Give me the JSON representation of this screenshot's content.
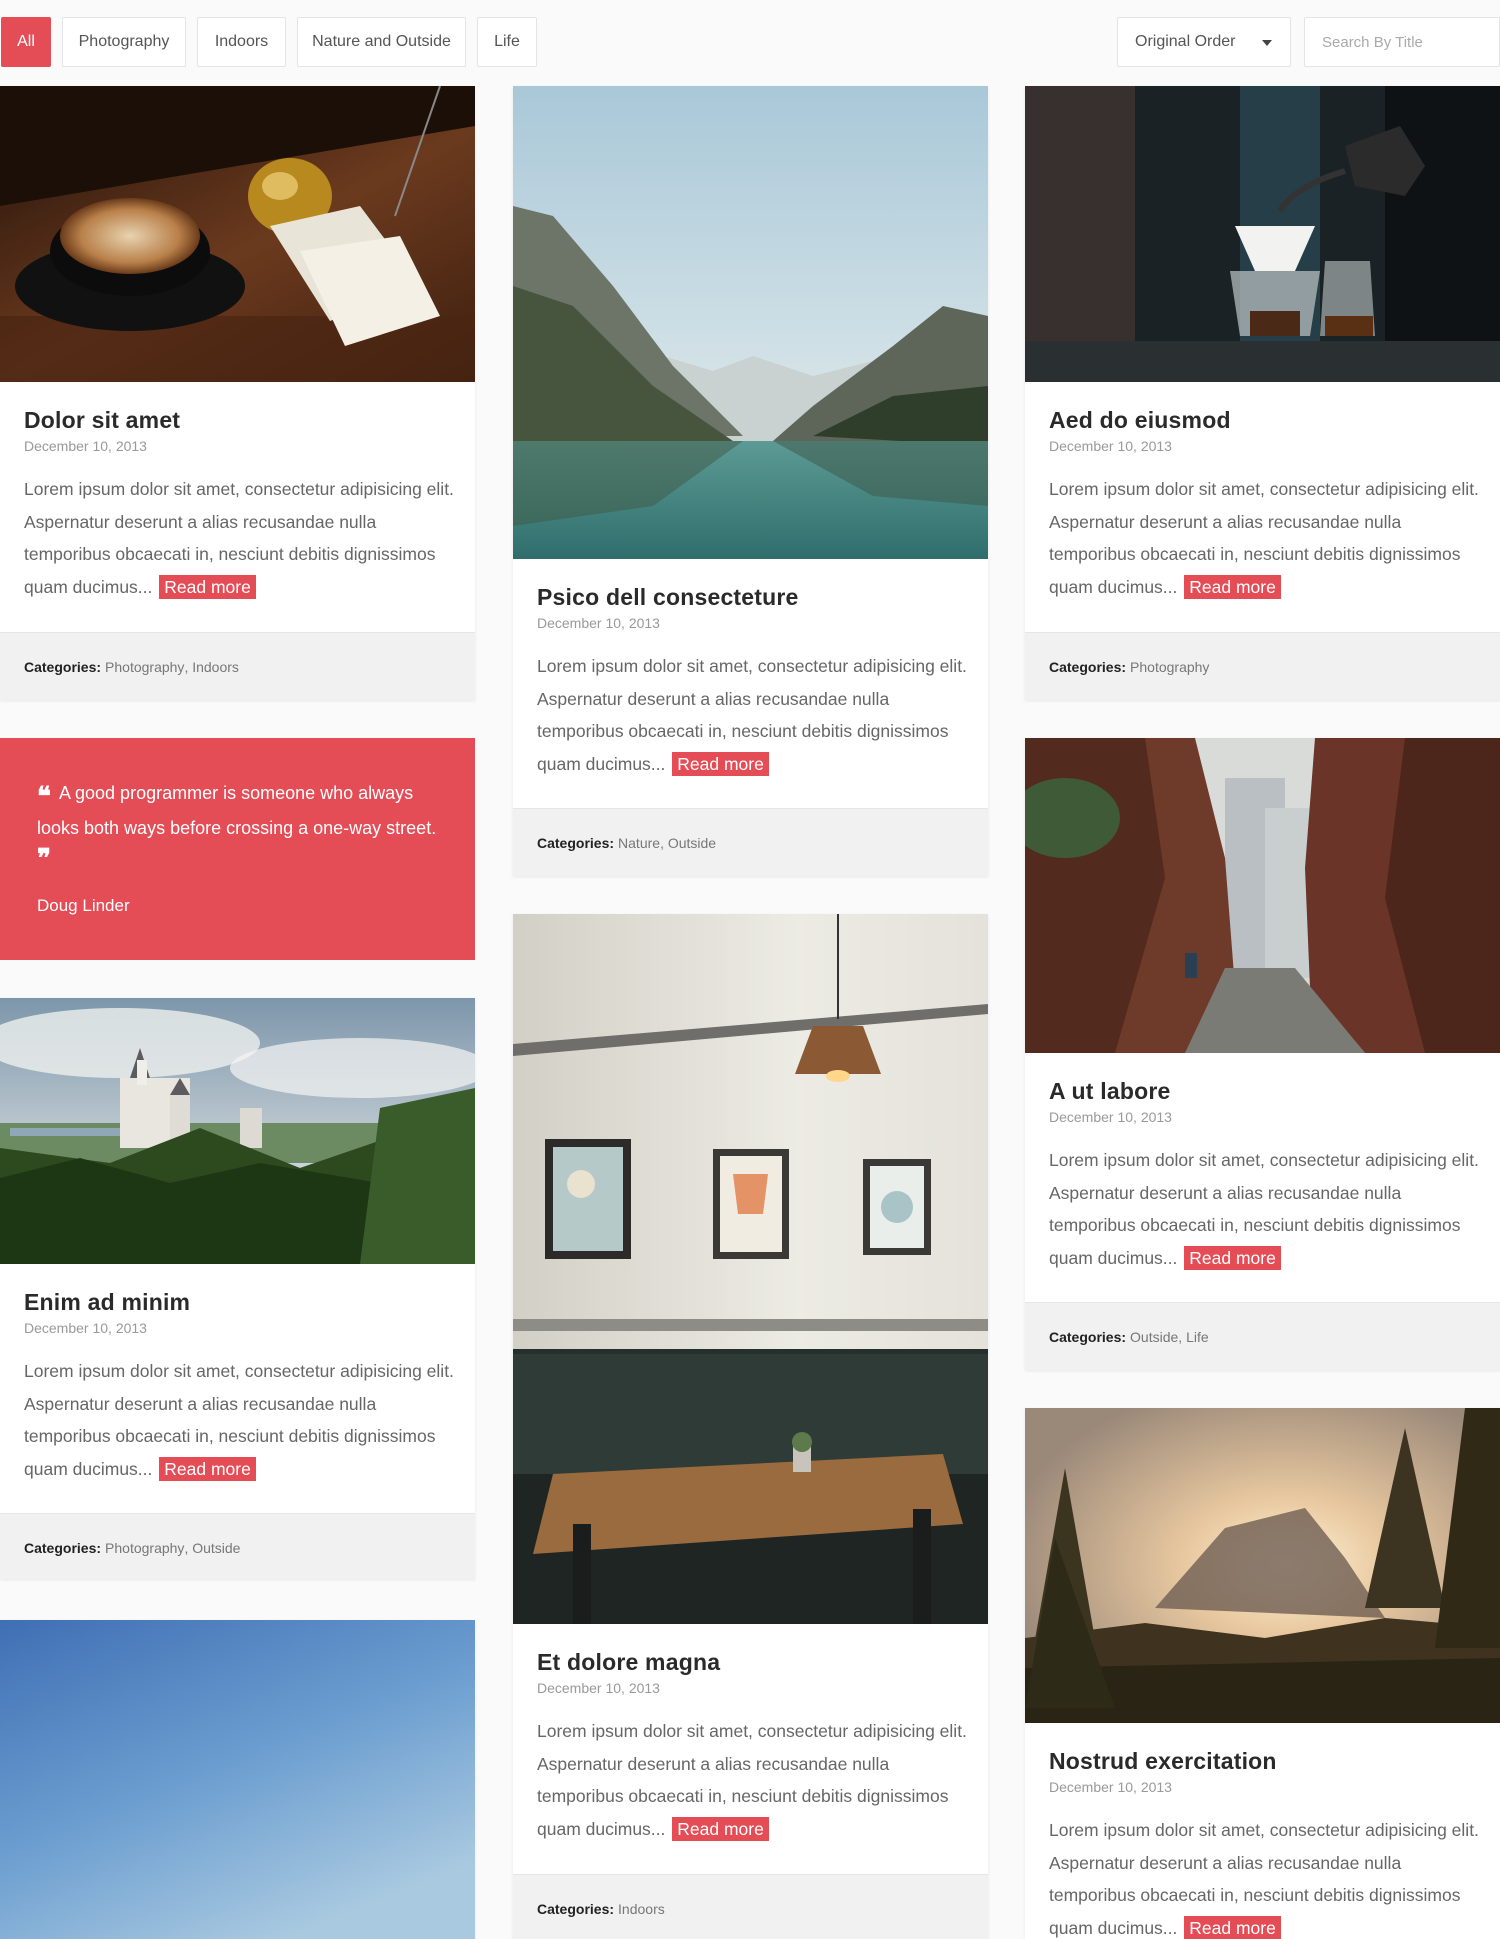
{
  "filters": [
    {
      "label": "All",
      "active": true
    },
    {
      "label": "Photography",
      "active": false
    },
    {
      "label": "Indoors",
      "active": false
    },
    {
      "label": "Nature and Outside",
      "active": false
    },
    {
      "label": "Life",
      "active": false
    }
  ],
  "sort": {
    "selected": "Original Order"
  },
  "search": {
    "placeholder": "Search By Title"
  },
  "colors": {
    "accent": "#e44c56",
    "footer_bg": "#f1f1f1",
    "page_bg": "#fafafa"
  },
  "read_more_label": "Read more",
  "categories_label": "Categories:",
  "posts": [
    {
      "title": "Dolor sit amet",
      "date": "December 10, 2013",
      "excerpt": "Lorem ipsum dolor sit amet, consectetur adipisicing elit. Aspernatur deserunt a alias recusandae nulla temporibus obcaecati in, nesciunt debitis dignissimos quam ducimus...",
      "categories": [
        "Photography",
        "Indoors"
      ],
      "image": "coffee-cup-photo"
    },
    {
      "title": "Psico dell consecteture",
      "date": "December 10, 2013",
      "excerpt": "Lorem ipsum dolor sit amet, consectetur adipisicing elit. Aspernatur deserunt a alias recusandae nulla temporibus obcaecati in, nesciunt debitis dignissimos quam ducimus...",
      "categories": [
        "Nature",
        "Outside"
      ],
      "image": "mountain-lake-photo"
    },
    {
      "title": "Aed do eiusmod",
      "date": "December 10, 2013",
      "excerpt": "Lorem ipsum dolor sit amet, consectetur adipisicing elit. Aspernatur deserunt a alias recusandae nulla temporibus obcaecati in, nesciunt debitis dignissimos quam ducimus...",
      "categories": [
        "Photography"
      ],
      "image": "coffee-brewing-photo"
    },
    {
      "title": "A ut labore",
      "date": "December 10, 2013",
      "excerpt": "Lorem ipsum dolor sit amet, consectetur adipisicing elit. Aspernatur deserunt a alias recusandae nulla temporibus obcaecati in, nesciunt debitis dignissimos quam ducimus...",
      "categories": [
        "Outside",
        "Life"
      ],
      "image": "brick-alley-photo"
    },
    {
      "title": "Enim ad minim",
      "date": "December 10, 2013",
      "excerpt": "Lorem ipsum dolor sit amet, consectetur adipisicing elit. Aspernatur deserunt a alias recusandae nulla temporibus obcaecati in, nesciunt debitis dignissimos quam ducimus...",
      "categories": [
        "Photography",
        "Outside"
      ],
      "image": "castle-forest-photo"
    },
    {
      "title": "Et dolore magna",
      "date": "December 10, 2013",
      "excerpt": "Lorem ipsum dolor sit amet, consectetur adipisicing elit. Aspernatur deserunt a alias recusandae nulla temporibus obcaecati in, nesciunt debitis dignissimos quam ducimus...",
      "categories": [
        "Indoors"
      ],
      "image": "cafe-interior-photo"
    },
    {
      "title": "Nostrud exercitation",
      "date": "December 10, 2013",
      "excerpt": "Lorem ipsum dolor sit amet, consectetur adipisicing elit. Aspernatur deserunt a alias recusandae nulla temporibus obcaecati in, nesciunt debitis dignissimos quam ducimus...",
      "image": "sunset-valley-photo"
    }
  ],
  "quote": {
    "text": "A good programmer is someone who always looks both ways before crossing a one-way street.",
    "author": "Doug Linder"
  },
  "sky_card": {
    "image": "blue-sky-photo"
  }
}
